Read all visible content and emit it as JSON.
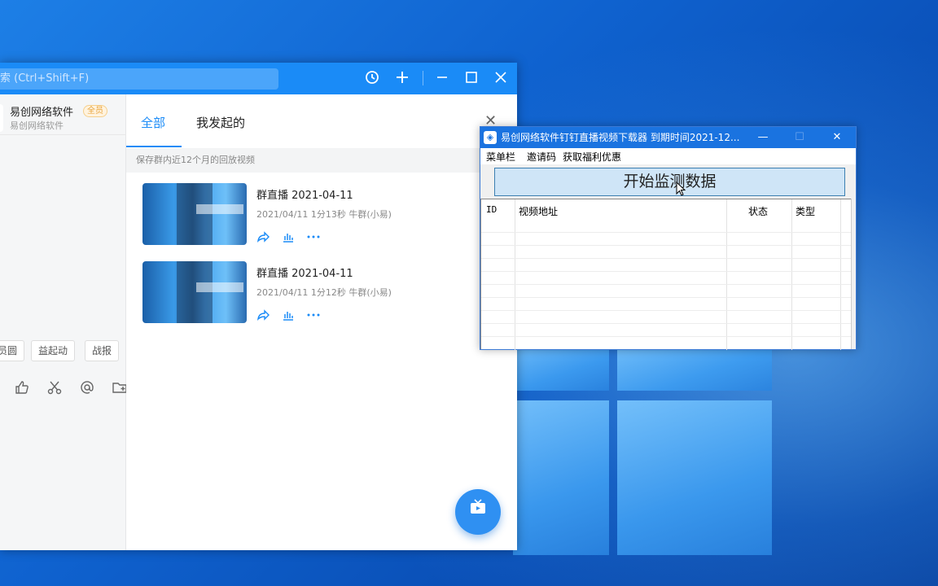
{
  "dingtalk": {
    "search_placeholder": "索 (Ctrl+Shift+F)",
    "contact": {
      "name": "易创网络软件",
      "badge": "全员",
      "subtitle": "易创网络软件"
    },
    "chips": [
      "员圆",
      "益起动",
      "战报"
    ],
    "tabs": [
      {
        "label": "全部"
      },
      {
        "label": "我发起的"
      }
    ],
    "notice": "保存群内近12个月的回放视频",
    "videos": [
      {
        "title": "群直播 2021-04-11",
        "meta": "2021/04/11 1分13秒 牛群(小易)"
      },
      {
        "title": "群直播 2021-04-11",
        "meta": "2021/04/11 1分12秒 牛群(小易)"
      }
    ],
    "icons": {
      "history": "history-icon",
      "add": "plus-icon",
      "minimize": "minimize-icon",
      "maximize": "maximize-icon",
      "close": "close-icon"
    }
  },
  "downloader": {
    "title": "易创网络软件钉钉直播视频下载器   到期时间2021-12...",
    "menu": [
      "菜单栏",
      "邀请码",
      "获取福利优惠"
    ],
    "start_button": "开始监测数据",
    "columns": [
      "ID",
      "视频地址",
      "状态",
      "类型"
    ]
  },
  "colors": {
    "accent": "#1a8bf7",
    "downloader_title": "#1a73e0"
  }
}
